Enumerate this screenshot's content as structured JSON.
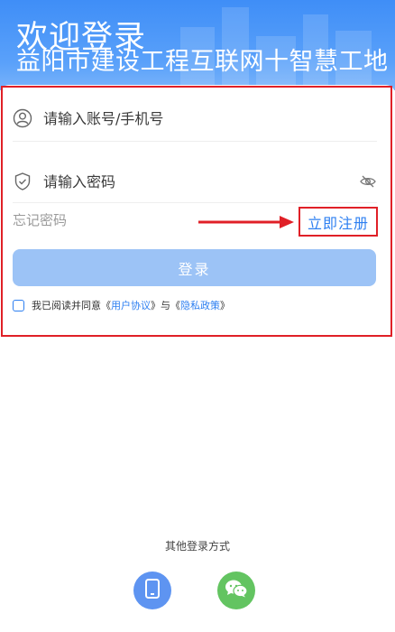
{
  "header": {
    "title": "欢迎登录",
    "subtitle": "益阳市建设工程互联网十智慧工地"
  },
  "form": {
    "account_placeholder": "请输入账号/手机号",
    "password_placeholder": "请输入密码",
    "forgot_label": "忘记密码",
    "register_label": "立即注册",
    "login_label": "登录"
  },
  "agreement": {
    "prefix": "我已阅读并同意",
    "lq1": "《",
    "user_agreement": "用户协议",
    "rq1": "》",
    "conj": "与",
    "lq2": "《",
    "privacy_policy": "隐私政策",
    "rq2": "》"
  },
  "other_login": {
    "title": "其他登录方式",
    "methods": [
      "phone-icon",
      "wechat-icon"
    ]
  },
  "colors": {
    "brand_blue": "#3f8ef7",
    "link_blue": "#2d7ff1",
    "button_disabled": "#9cc3f6",
    "annotation_red": "#e02027",
    "wechat_green": "#63c461",
    "phone_blue": "#5e94f1"
  }
}
